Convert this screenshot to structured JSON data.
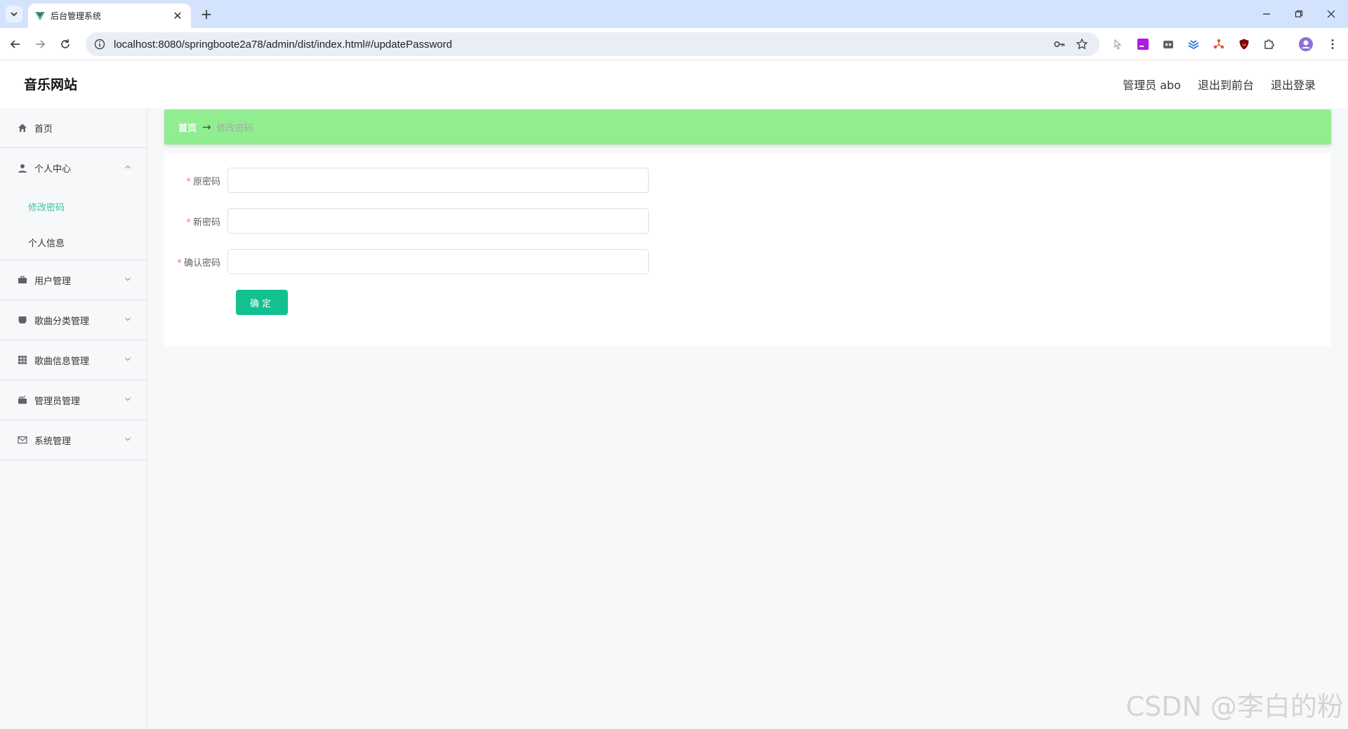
{
  "browser": {
    "tab_title": "后台管理系统",
    "url": "localhost:8080/springboote2a78/admin/dist/index.html#/updatePassword"
  },
  "app": {
    "title": "音乐网站",
    "header_links": [
      "管理员 abo",
      "退出到前台",
      "退出登录"
    ]
  },
  "sidebar": {
    "home": "首页",
    "personal_center": "个人中心",
    "personal_sub": [
      "修改密码",
      "个人信息"
    ],
    "groups": [
      "用户管理",
      "歌曲分类管理",
      "歌曲信息管理",
      "管理员管理",
      "系统管理"
    ]
  },
  "breadcrumb": {
    "home": "首页",
    "separator": "→",
    "current": "修改密码"
  },
  "form": {
    "required_mark": "*",
    "fields": [
      {
        "label": "原密码",
        "value": ""
      },
      {
        "label": "新密码",
        "value": ""
      },
      {
        "label": "确认密码",
        "value": ""
      }
    ],
    "submit_label": "确定"
  },
  "watermark": "CSDN @李白的粉",
  "colors": {
    "accent": "#3cc6a4",
    "button": "#13c08f",
    "breadcrumb_bg": "#90ee90",
    "required": "#f56c6c"
  }
}
